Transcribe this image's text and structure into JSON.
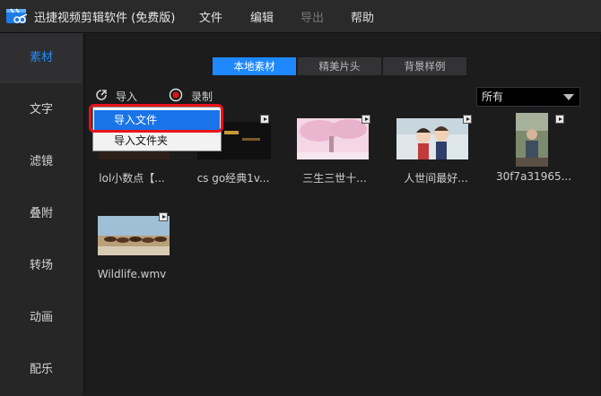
{
  "app": {
    "title": "迅捷视频剪辑软件 (免费版)",
    "menu": [
      "文件",
      "编辑",
      "导出",
      "帮助"
    ]
  },
  "sidebar": {
    "items": [
      {
        "label": "素材",
        "active": true
      },
      {
        "label": "文字"
      },
      {
        "label": "滤镜"
      },
      {
        "label": "叠附"
      },
      {
        "label": "转场"
      },
      {
        "label": "动画"
      },
      {
        "label": "配乐"
      }
    ]
  },
  "tabs": [
    {
      "label": "本地素材",
      "active": true
    },
    {
      "label": "精美片头"
    },
    {
      "label": "背景样例"
    }
  ],
  "toolbar": {
    "import_label": "导入",
    "record_label": "录制"
  },
  "filter": {
    "selected": "所有"
  },
  "import_menu": {
    "items": [
      "导入文件",
      "导入文件夹"
    ],
    "selected_index": 0
  },
  "media": [
    {
      "label": "lol小数点【..."
    },
    {
      "label": "cs go经典1v..."
    },
    {
      "label": "三生三世十..."
    },
    {
      "label": "人世间最好..."
    },
    {
      "label": "30f7a31965..."
    },
    {
      "label": "Wildlife.wmv"
    }
  ],
  "colors": {
    "accent": "#1e88ff",
    "highlight": "#e8141b"
  }
}
